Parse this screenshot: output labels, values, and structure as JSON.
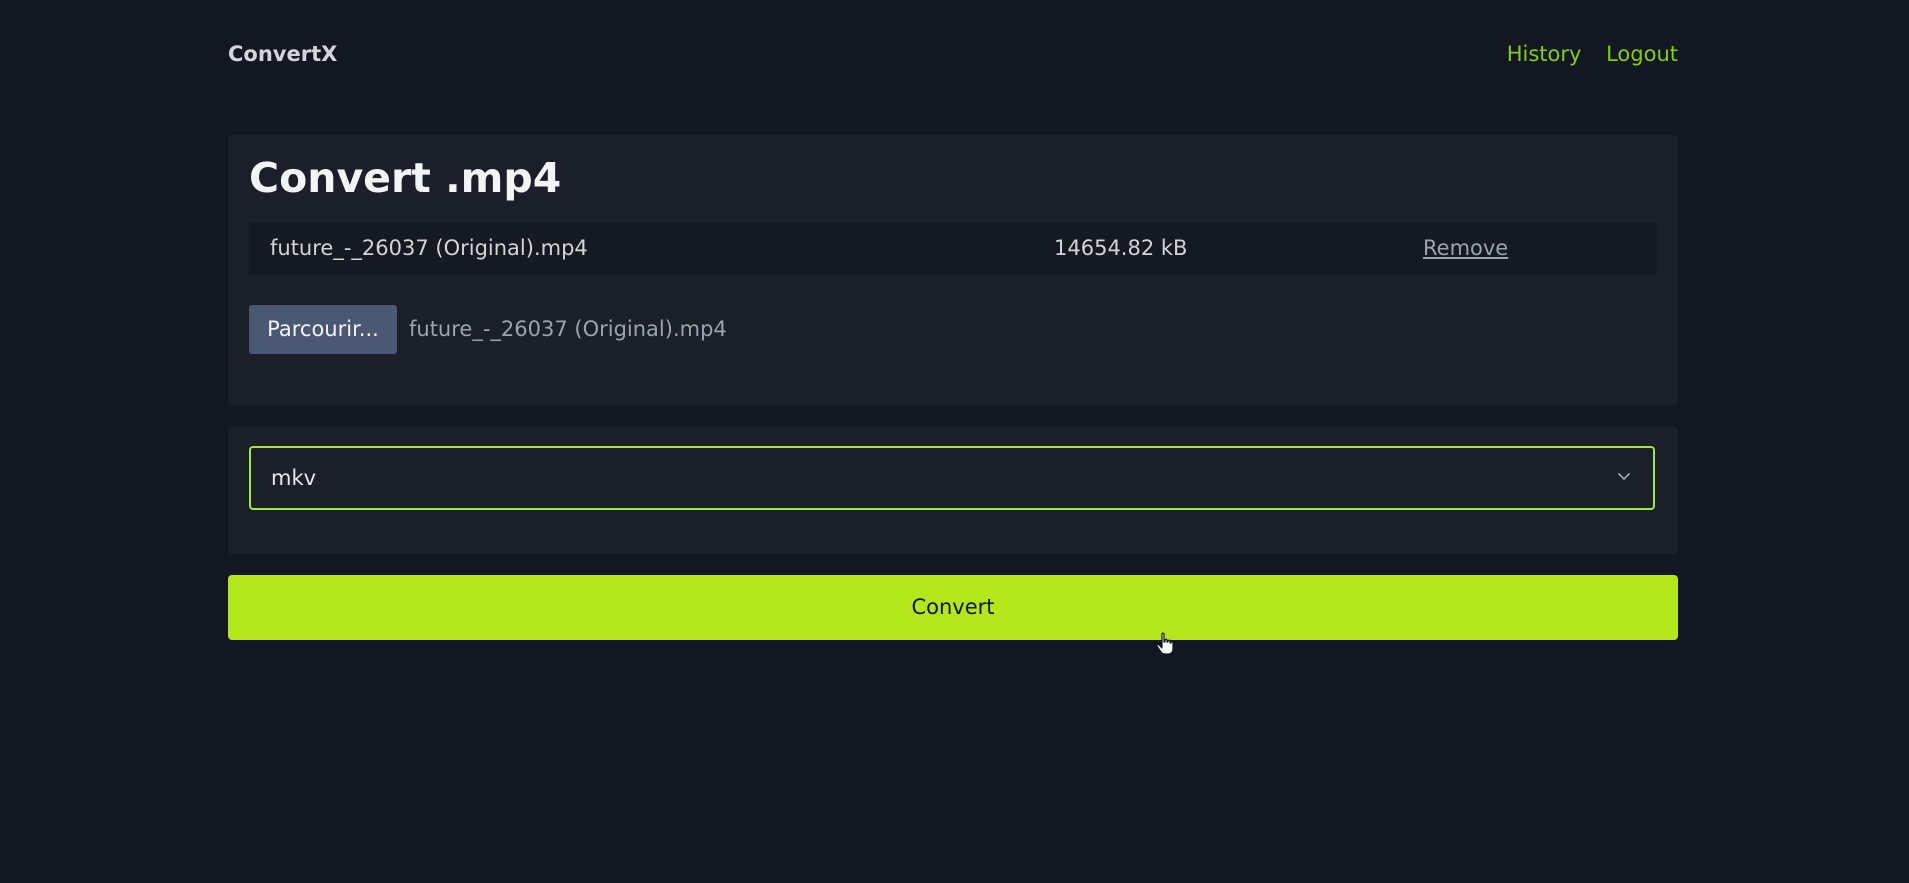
{
  "header": {
    "brand": "ConvertX",
    "nav": {
      "history": "History",
      "logout": "Logout"
    }
  },
  "convert": {
    "title": "Convert .mp4",
    "file": {
      "name": "future_-_26037 (Original).mp4",
      "size": "14654.82 kB",
      "remove": "Remove"
    },
    "picker": {
      "button": "Parcourir...",
      "selected": "future_-_26037 (Original).mp4"
    }
  },
  "format_select": {
    "value": "mkv",
    "icon": "chevron-down-icon"
  },
  "action": {
    "convert": "Convert"
  },
  "colors": {
    "background": "#121722",
    "card": "#1a1f2a",
    "accent": "#b3e61b",
    "link": "#84cc16"
  }
}
